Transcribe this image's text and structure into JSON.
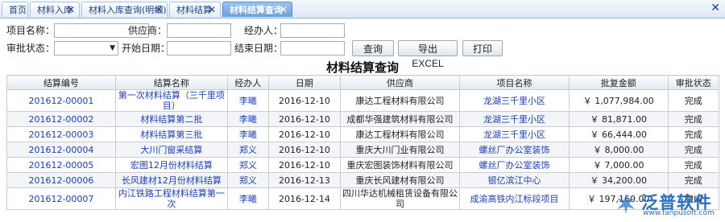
{
  "tabs": [
    {
      "label": "首页",
      "closable": false,
      "active": false
    },
    {
      "label": "材料入库",
      "closable": true,
      "active": false
    },
    {
      "label": "材料入库查询(明细)",
      "closable": true,
      "active": false
    },
    {
      "label": "材料结算",
      "closable": true,
      "active": false
    },
    {
      "label": "材料结算查询",
      "closable": true,
      "active": true
    }
  ],
  "filters": {
    "project_name_label": "项目名称：",
    "project_name_value": "",
    "supplier_label": "供应商：",
    "supplier_value": "",
    "handler_label": "经办人：",
    "handler_value": "",
    "approval_label": "审批状态：",
    "approval_value": "",
    "start_date_label": "开始日期：",
    "start_date_value": "",
    "end_date_label": "结束日期：",
    "end_date_value": ""
  },
  "buttons": {
    "query": "查询",
    "export": "导出EXCEL",
    "print": "打印"
  },
  "report_title": "材料结算查询",
  "columns": [
    "结算编号",
    "结算名称",
    "经办人",
    "日期",
    "供应商",
    "项目名称",
    "批复金额",
    "审批状态"
  ],
  "rows": [
    {
      "code": "201612-00001",
      "name": "第一次材料结算（三千里项目）",
      "handler": "李曦",
      "date": "2016-12-10",
      "supplier": "康达工程材料有限公司",
      "project": "龙湖三千里小区",
      "amount": "￥ 1,077,984.00",
      "status": "完成"
    },
    {
      "code": "201612-00002",
      "name": "材料结算第二批",
      "handler": "李曦",
      "date": "2016-12-10",
      "supplier": "成都华强建筑材料有限公司",
      "project": "龙湖三千里小区",
      "amount": "￥ 81,871.00",
      "status": "完成"
    },
    {
      "code": "201612-00003",
      "name": "材料结算第三批",
      "handler": "李曦",
      "date": "2016-12-10",
      "supplier": "康达工程材料有限公司",
      "project": "龙湖三千里小区",
      "amount": "￥ 66,444.00",
      "status": "完成"
    },
    {
      "code": "201612-00004",
      "name": "大川门窗采结算",
      "handler": "郑义",
      "date": "2016-12-10",
      "supplier": "重庆大川门业有限公司",
      "project": "螺丝厂办公室装饰",
      "amount": "￥ 8,000.00",
      "status": "完成"
    },
    {
      "code": "201612-00005",
      "name": "宏图12月份材料结算",
      "handler": "郑义",
      "date": "2016-12-10",
      "supplier": "重庆宏图装饰材料有限公司",
      "project": "螺丝厂办公室装饰",
      "amount": "￥ 7,000.00",
      "status": "完成"
    },
    {
      "code": "201612-00006",
      "name": "长风建材12月份材料结算",
      "handler": "郑义",
      "date": "2016-12-13",
      "supplier": "重庆长风建材有限公司",
      "project": "银亿滨江中心",
      "amount": "￥ 34,200.00",
      "status": "完成"
    },
    {
      "code": "201612-00007",
      "name": "内江铁路工程材料结算第一次",
      "handler": "李曦",
      "date": "2016-12-14",
      "supplier": "四川华达机械租赁设备有限公司",
      "project": "成渝高铁内江标段项目",
      "amount": "￥ 197,160.00",
      "status": "完成"
    }
  ],
  "brand": {
    "name": "泛普软件",
    "url": "www.fanpusoft.com",
    "color": "#2b6fc4"
  }
}
